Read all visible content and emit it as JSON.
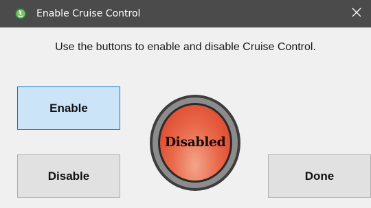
{
  "window": {
    "title": "Enable Cruise Control",
    "app_icon": "java-icon",
    "close_icon": "close-icon"
  },
  "main": {
    "instructions": "Use the buttons to enable and disable Cruise Control."
  },
  "buttons": {
    "enable_label": "Enable",
    "disable_label": "Disable",
    "done_label": "Done"
  },
  "status": {
    "label": "Disabled",
    "state": "disabled",
    "lamp_color": "#e8553a"
  },
  "colors": {
    "titlebar": "#4b4b4b",
    "focused_button_bg": "#cce4f7",
    "focused_button_border": "#0078d7",
    "button_bg": "#e1e1e1"
  }
}
